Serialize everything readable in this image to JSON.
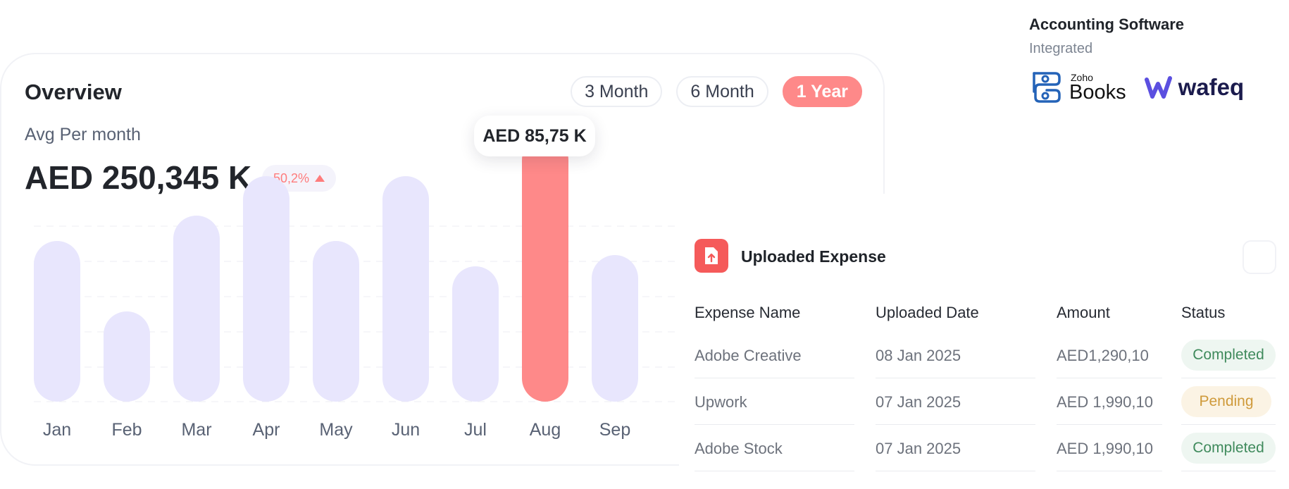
{
  "overview": {
    "title": "Overview",
    "ranges": [
      "3 Month",
      "6 Month",
      "1 Year"
    ],
    "active_range": "1 Year",
    "avg_label": "Avg Per month",
    "avg_value": "AED 250,345 K",
    "change": "50,2%",
    "tooltip": "AED 85,75 K",
    "colors": {
      "bar": "#e8e6fd",
      "highlight": "#fe8989"
    }
  },
  "chart_data": {
    "type": "bar",
    "categories": [
      "Jan",
      "Feb",
      "Mar",
      "Apr",
      "May",
      "Jun",
      "Jul",
      "Aug",
      "Sep"
    ],
    "values": [
      57,
      32,
      66,
      80,
      57,
      80,
      48,
      94,
      52
    ],
    "highlighted_category": "Aug",
    "ylim": [
      0,
      100
    ],
    "grid": "dashed horizontal"
  },
  "accounting": {
    "title": "Accounting Software",
    "subtitle": "Integrated",
    "logos": [
      {
        "name": "zoho-books",
        "small": "Zoho",
        "big": "Books"
      },
      {
        "name": "wafeq",
        "text": "wafeq"
      }
    ]
  },
  "expenses": {
    "title": "Uploaded Expense",
    "headers": [
      "Expense Name",
      "Uploaded Date",
      "Amount",
      "Status"
    ],
    "rows": [
      {
        "name": "Adobe Creative",
        "date": "08 Jan 2025",
        "amount": "AED1,290,10",
        "status": "Completed"
      },
      {
        "name": "Upwork",
        "date": "07 Jan 2025",
        "amount": "AED 1,990,10",
        "status": "Pending"
      },
      {
        "name": "Adobe Stock",
        "date": "07 Jan 2025",
        "amount": "AED 1,990,10",
        "status": "Completed"
      }
    ]
  }
}
